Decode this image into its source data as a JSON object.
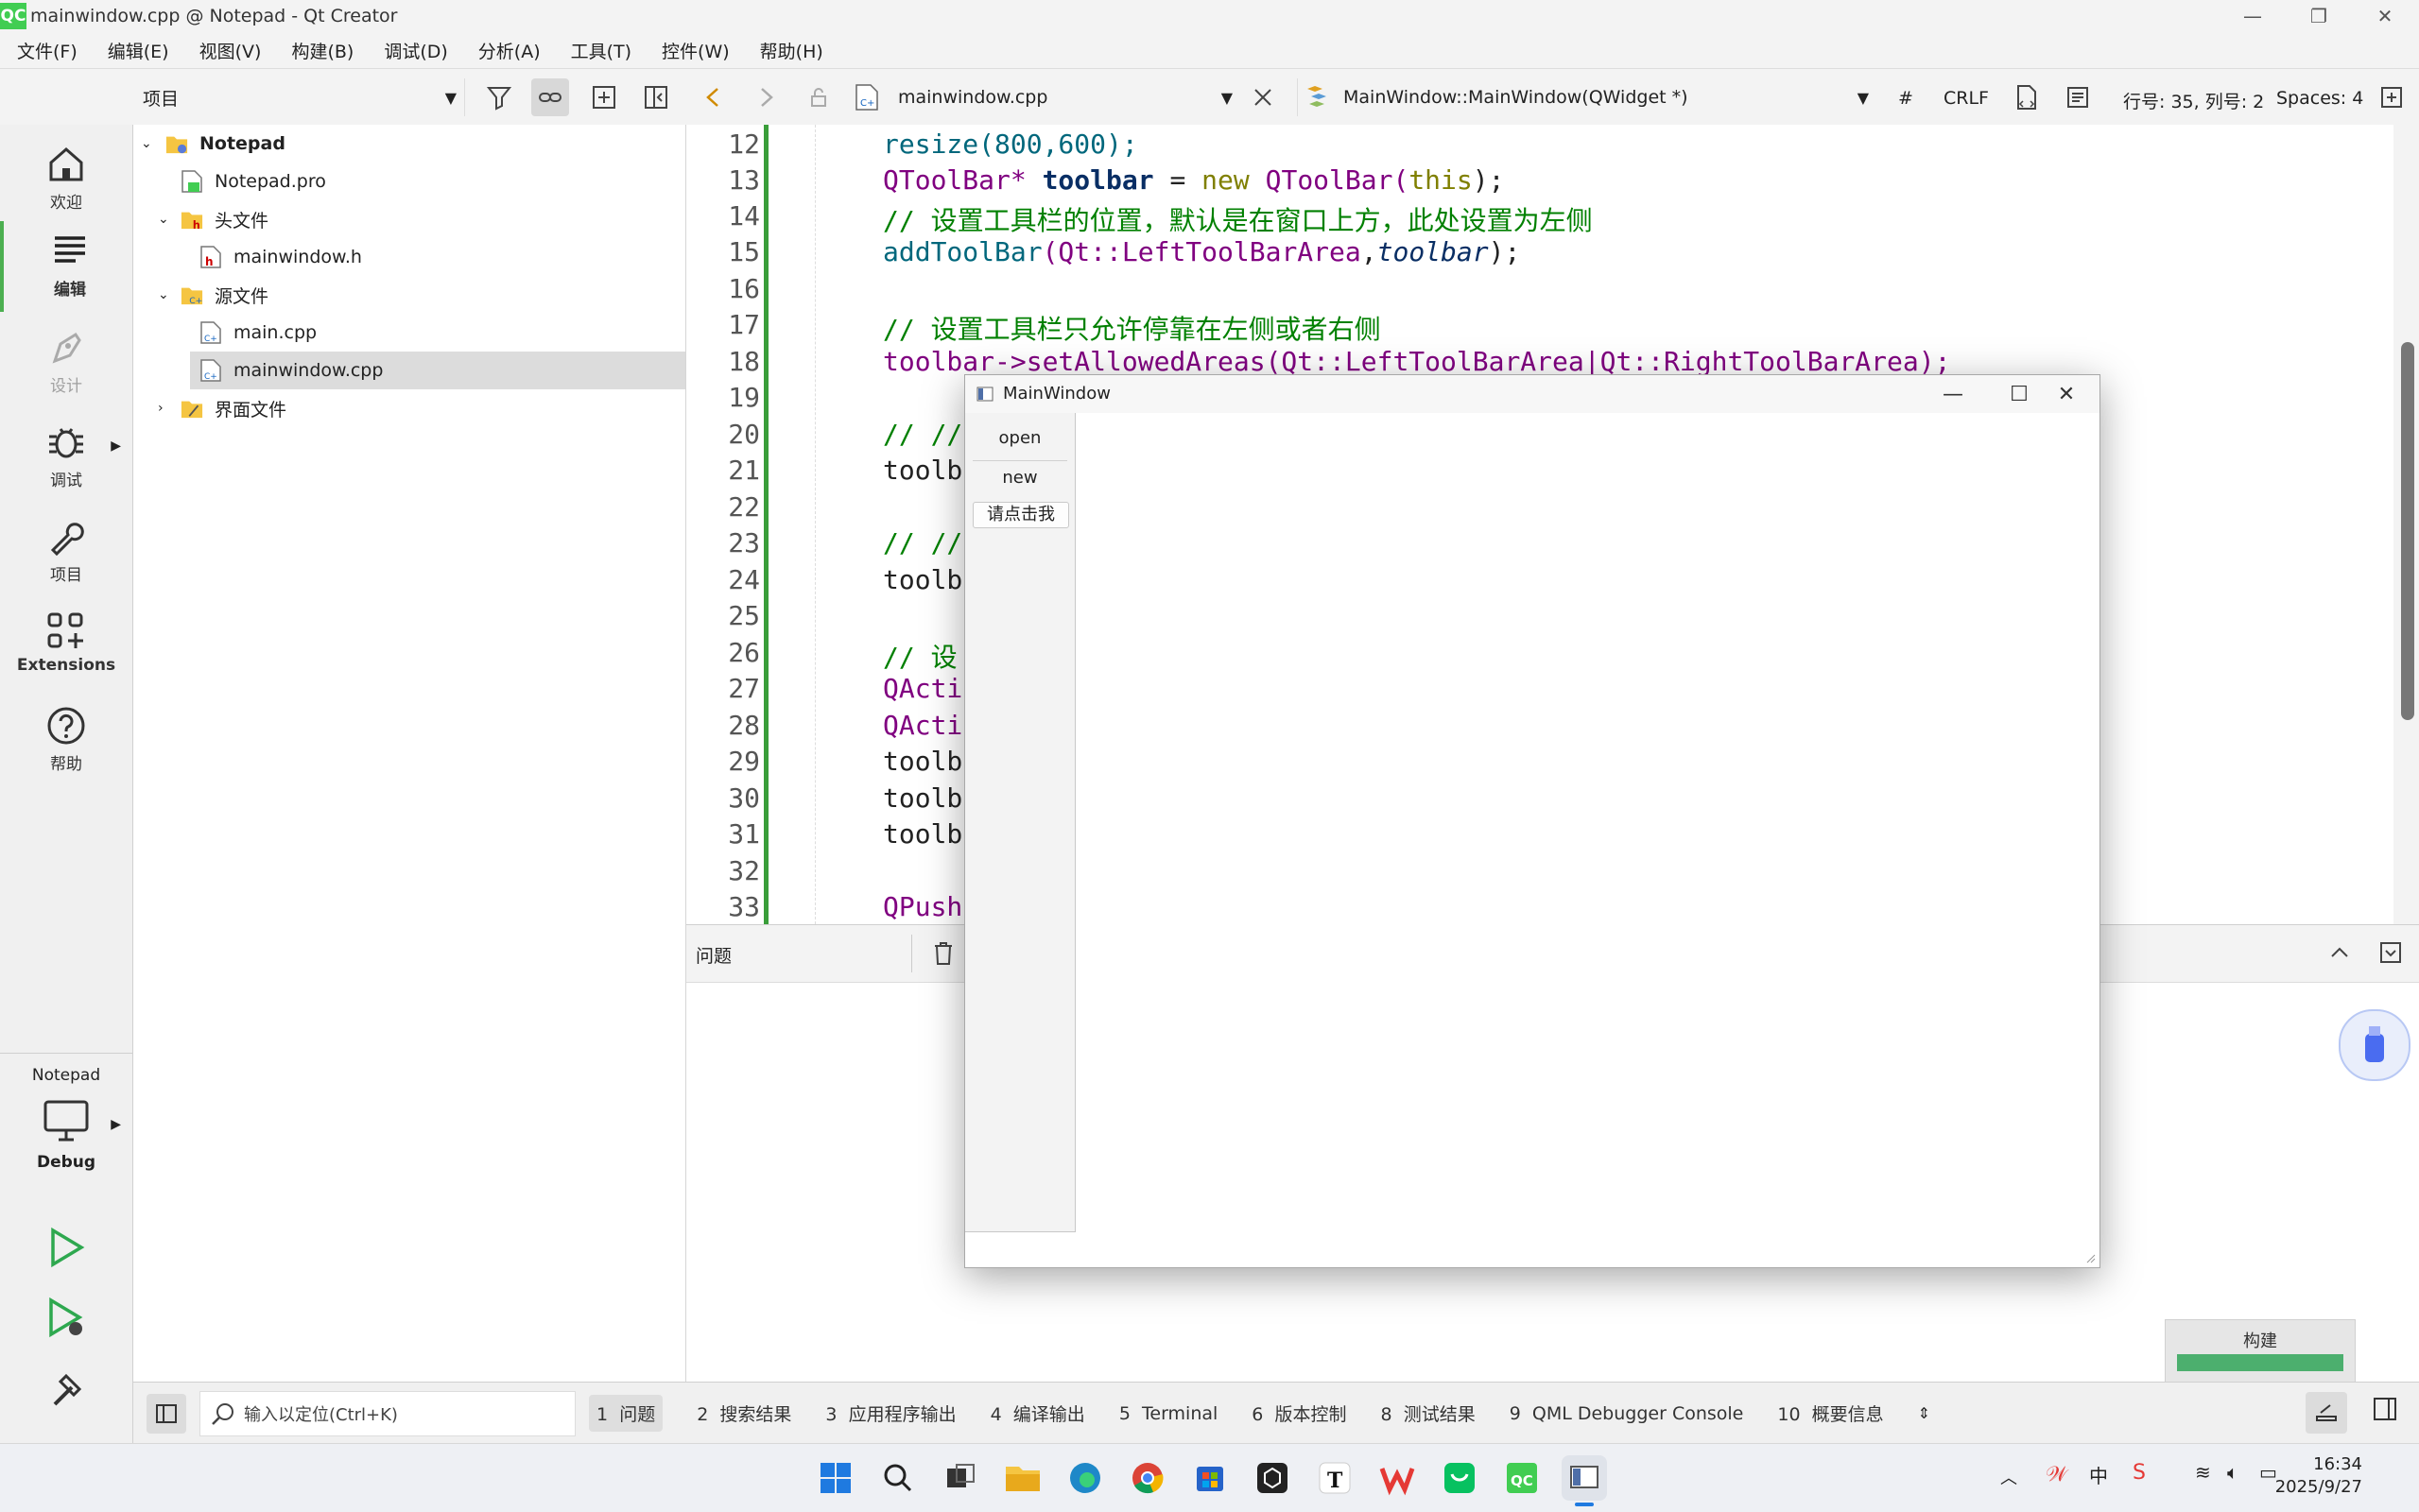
{
  "window": {
    "app_icon_text": "QC",
    "title": "mainwindow.cpp @ Notepad - Qt Creator"
  },
  "menu": [
    "文件(F)",
    "编辑(E)",
    "视图(V)",
    "构建(B)",
    "调试(D)",
    "分析(A)",
    "工具(T)",
    "控件(W)",
    "帮助(H)"
  ],
  "toolbar": {
    "project_selector": "项目",
    "file_selector": "mainwindow.cpp",
    "symbol_selector": "MainWindow::MainWindow(QWidget *)",
    "hash": "#",
    "line_ending": "CRLF",
    "position": "行号: 35, 列号: 2",
    "spaces": "Spaces: 4"
  },
  "modes": [
    {
      "label": "欢迎",
      "icon": "home-icon"
    },
    {
      "label": "编辑",
      "icon": "edit-icon"
    },
    {
      "label": "设计",
      "icon": "design-icon"
    },
    {
      "label": "调试",
      "icon": "debug-icon"
    },
    {
      "label": "项目",
      "icon": "wrench-icon"
    },
    {
      "label": "Extensions",
      "icon": "extensions-icon"
    },
    {
      "label": "帮助",
      "icon": "help-icon"
    }
  ],
  "kit": {
    "project": "Notepad",
    "config": "Debug"
  },
  "tree": [
    {
      "label": "Notepad",
      "level": 0
    },
    {
      "label": "Notepad.pro",
      "level": 1
    },
    {
      "label": "头文件",
      "level": 1
    },
    {
      "label": "mainwindow.h",
      "level": 2
    },
    {
      "label": "源文件",
      "level": 1
    },
    {
      "label": "main.cpp",
      "level": 2
    },
    {
      "label": "mainwindow.cpp",
      "level": 2
    },
    {
      "label": "界面文件",
      "level": 1
    }
  ],
  "code": {
    "line_numbers": [
      "12",
      "13",
      "14",
      "15",
      "16",
      "17",
      "18",
      "19",
      "20",
      "21",
      "22",
      "23",
      "24",
      "25",
      "26",
      "27",
      "28",
      "29",
      "30",
      "31",
      "32",
      "33"
    ],
    "l12": "resize(800,600);",
    "l13_type": "QToolBar*",
    "l13_var": "toolbar",
    "l13_eq": " = ",
    "l13_new": "new",
    "l13_rest": " QToolBar(",
    "l13_this": "this",
    "l13_end": ");",
    "l14": "// 设置工具栏的位置，默认是在窗口上方，此处设置为左侧",
    "l15_fn": "addToolBar",
    "l15_a": "(Qt::",
    "l15_b": "LeftToolBarArea",
    "l15_c": ",",
    "l15_d": "toolbar",
    "l15_e": ");",
    "l17": "// 设置工具栏只允许停靠在左侧或者右侧",
    "l18": "toolbar->setAllowedAreas(Qt::LeftToolBarArea|Qt::RightToolBarArea);",
    "l20": "// //",
    "l21": "toolb",
    "l23": "// //",
    "l24": "toolb",
    "l26": "// 设",
    "l27": "QActi",
    "l28": "QActi",
    "l29": "toolb",
    "l30": "toolb",
    "l31": "toolb",
    "l33": "QPush"
  },
  "issues": {
    "title": "问题"
  },
  "outputs": [
    {
      "num": "1",
      "label": "问题"
    },
    {
      "num": "2",
      "label": "搜索结果"
    },
    {
      "num": "3",
      "label": "应用程序输出"
    },
    {
      "num": "4",
      "label": "编译输出"
    },
    {
      "num": "5",
      "label": "Terminal"
    },
    {
      "num": "6",
      "label": "版本控制"
    },
    {
      "num": "8",
      "label": "测试结果"
    },
    {
      "num": "9",
      "label": "QML Debugger Console"
    },
    {
      "num": "10",
      "label": "概要信息"
    }
  ],
  "locator": {
    "placeholder": "输入以定位(Ctrl+K)"
  },
  "build": {
    "label": "构建"
  },
  "mainwindow": {
    "title": "MainWindow",
    "actions": [
      "open",
      "new"
    ],
    "push_button": "请点击我"
  },
  "taskbar": {
    "time": "16:34",
    "date": "2025/9/27"
  },
  "colors": {
    "accent_green": "#41cd52",
    "comment": "#008000",
    "keyword": "#808000",
    "type": "#800080"
  }
}
